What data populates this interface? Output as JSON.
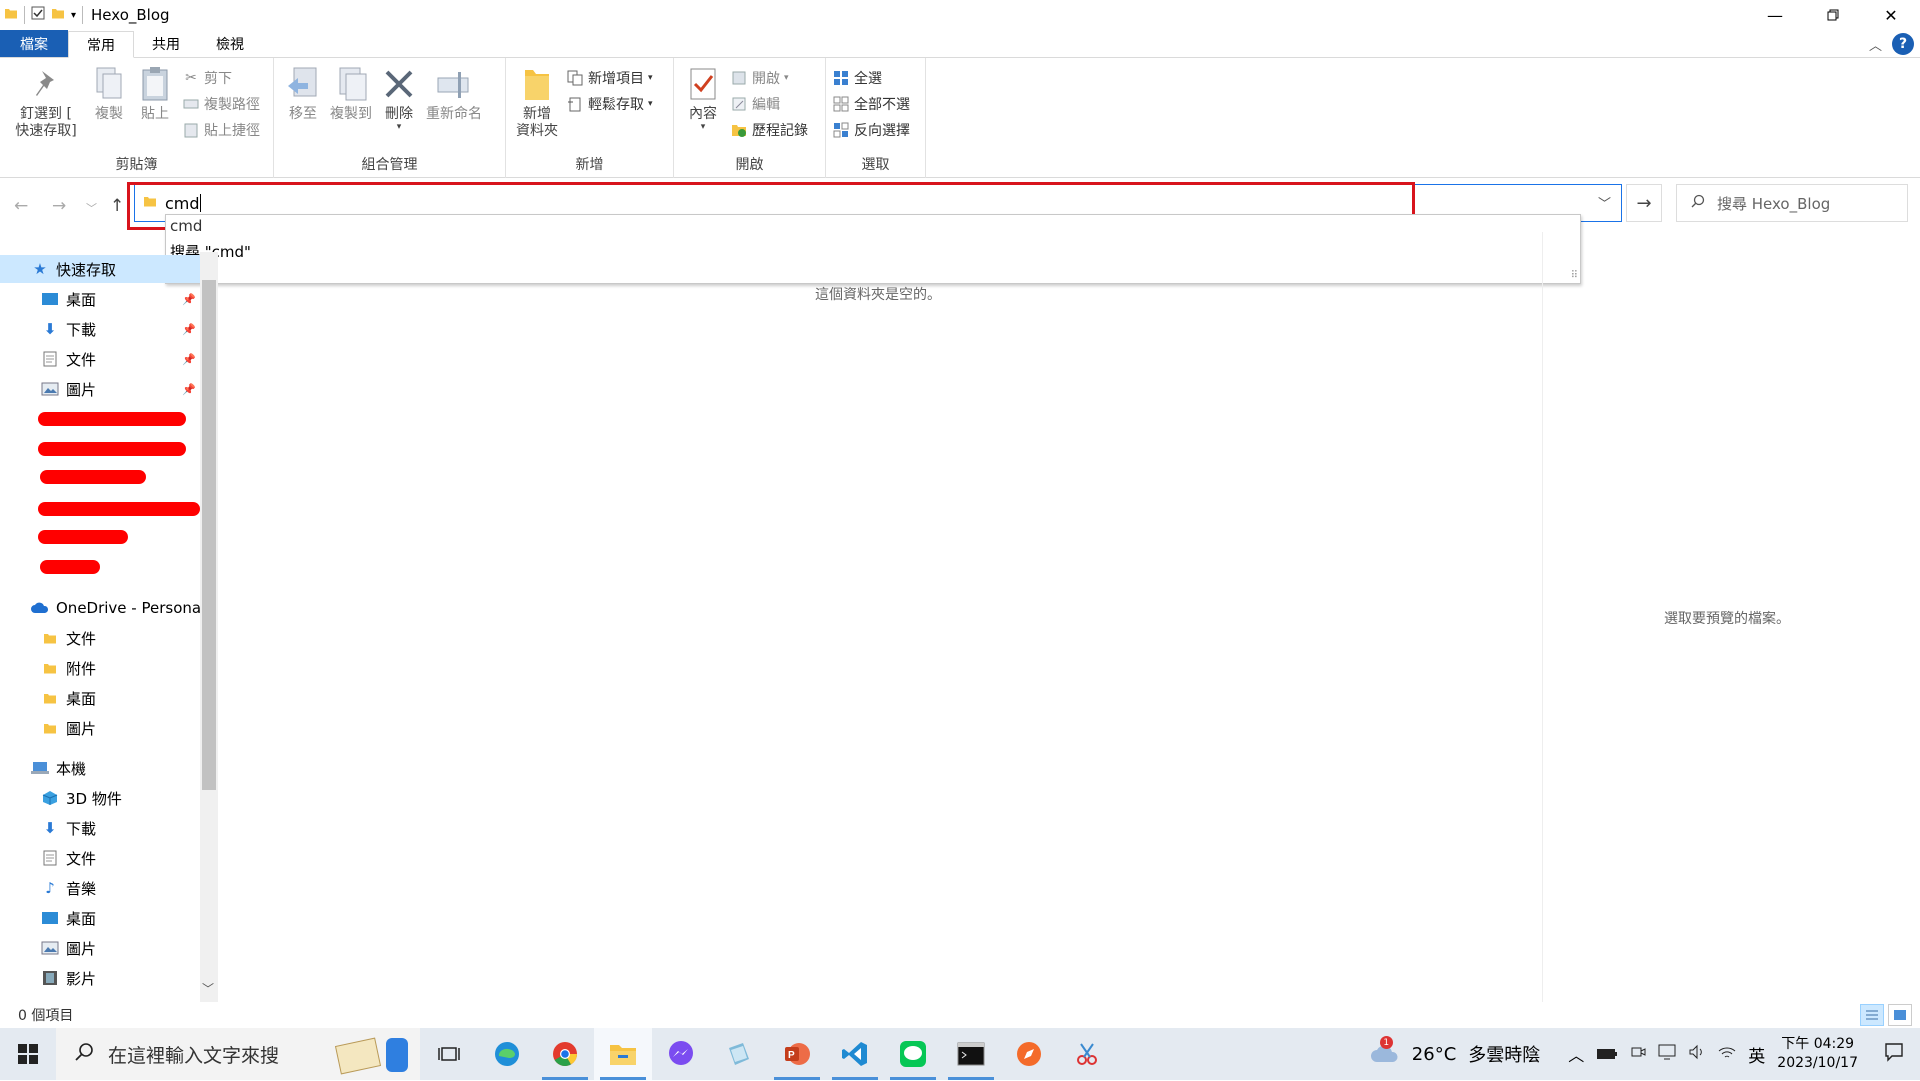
{
  "window": {
    "title": "Hexo_Blog",
    "controls": [
      "minimize-icon",
      "restore-icon",
      "close-icon"
    ]
  },
  "ribbon_tabs": [
    {
      "label": "檔案",
      "kind": "file"
    },
    {
      "label": "常用",
      "kind": "active"
    },
    {
      "label": "共用",
      "kind": ""
    },
    {
      "label": "檢視",
      "kind": ""
    }
  ],
  "ribbon": {
    "clipboard": {
      "label": "剪貼簿",
      "pin": "釘選到 [\n快速存取]",
      "copy": "複製",
      "paste": "貼上",
      "cut": "剪下",
      "copy_path": "複製路徑",
      "paste_shortcut": "貼上捷徑"
    },
    "organize": {
      "label": "組合管理",
      "move_to": "移至",
      "copy_to": "複製到",
      "delete": "刪除",
      "rename": "重新命名"
    },
    "new": {
      "label": "新增",
      "new_folder": "新增\n資料夾",
      "new_item": "新增項目",
      "easy_access": "輕鬆存取"
    },
    "open": {
      "label": "開啟",
      "properties": "內容",
      "open": "開啟",
      "edit": "編輯",
      "history": "歷程記錄"
    },
    "select": {
      "label": "選取",
      "select_all": "全選",
      "select_none": "全部不選",
      "invert": "反向選擇"
    }
  },
  "address": {
    "value": "cmd",
    "autocomplete": [
      "cmd",
      "搜尋 \"cmd\""
    ]
  },
  "search": {
    "placeholder": "搜尋 Hexo_Blog"
  },
  "sidebar": {
    "quick_access": "快速存取",
    "quick_items": [
      "桌面",
      "下載",
      "文件",
      "圖片"
    ],
    "onedrive": "OneDrive - Personal",
    "onedrive_items": [
      "文件",
      "附件",
      "桌面",
      "圖片"
    ],
    "this_pc": "本機",
    "pc_items": [
      "3D 物件",
      "下載",
      "文件",
      "音樂",
      "桌面",
      "圖片",
      "影片"
    ]
  },
  "content": {
    "empty_message": "這個資料夾是空的。",
    "preview_message": "選取要預覽的檔案。"
  },
  "status": {
    "item_count": "0 個項目"
  },
  "taskbar": {
    "search_placeholder": "在這裡輸入文字來搜",
    "weather_temp": "26°C",
    "weather_desc": "多雲時陰",
    "ime": "英",
    "time": "下午 04:29",
    "date": "2023/10/17",
    "weather_badge": "1"
  }
}
